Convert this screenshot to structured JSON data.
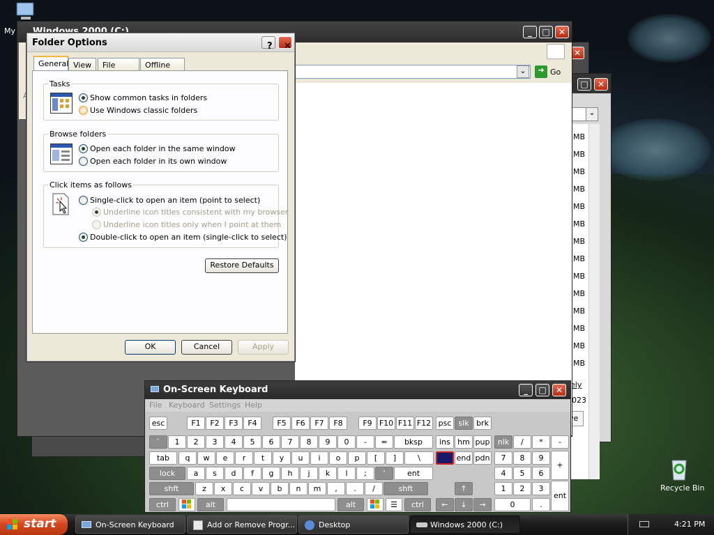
{
  "desktop": {
    "my_computer_label": "My",
    "recycle_bin_label": "Recycle Bin"
  },
  "explorer": {
    "title": "Windows 2000 (C:)",
    "go_label": "Go",
    "size_unit": "MB",
    "partial_link_1": "ely",
    "partial_text_2": "023",
    "partial_text_3": "ve",
    "partial_letter": "A"
  },
  "folder_options": {
    "title": "Folder Options",
    "tabs": [
      "General",
      "View",
      "File Types",
      "Offline Files"
    ],
    "tasks_group": "Tasks",
    "tasks_options": [
      "Show common tasks in folders",
      "Use Windows classic folders"
    ],
    "browse_group": "Browse folders",
    "browse_options": [
      "Open each folder in the same window",
      "Open each folder in its own window"
    ],
    "click_group": "Click items as follows",
    "click_options": [
      "Single-click to open an item (point to select)",
      "Underline icon titles consistent with my browser",
      "Underline icon titles only when I point at them",
      "Double-click to open an item (single-click to select)"
    ],
    "restore_defaults": "Restore Defaults",
    "ok": "OK",
    "cancel": "Cancel",
    "apply": "Apply",
    "help_glyph": "?",
    "close_glyph": "✕"
  },
  "osk": {
    "title": "On-Screen Keyboard",
    "menu": [
      "File",
      "Keyboard",
      "Settings",
      "Help"
    ],
    "row1": [
      "esc",
      "F1",
      "F2",
      "F3",
      "F4",
      "F5",
      "F6",
      "F7",
      "F8",
      "F9",
      "F10",
      "F11",
      "F12",
      "psc",
      "slk",
      "brk"
    ],
    "row2": [
      "`",
      "1",
      "2",
      "3",
      "4",
      "5",
      "6",
      "7",
      "8",
      "9",
      "0",
      "-",
      "=",
      "bksp",
      "ins",
      "hm",
      "pup",
      "nlk",
      "/",
      "*",
      "-"
    ],
    "row3": [
      "tab",
      "q",
      "w",
      "e",
      "r",
      "t",
      "y",
      "u",
      "i",
      "o",
      "p",
      "[",
      "]",
      "\\",
      "",
      "end",
      "pdn",
      "7",
      "8",
      "9"
    ],
    "row4": [
      "lock",
      "a",
      "s",
      "d",
      "f",
      "g",
      "h",
      "j",
      "k",
      "l",
      ";",
      "'",
      "ent",
      "4",
      "5",
      "6",
      "+"
    ],
    "row5": [
      "shft",
      "z",
      "x",
      "c",
      "v",
      "b",
      "n",
      "m",
      ",",
      ".",
      "/",
      "shft",
      "↑",
      "1",
      "2",
      "3"
    ],
    "row6": [
      "ctrl",
      "alt",
      "",
      "alt",
      "ctrl",
      "←",
      "↓",
      "→",
      "0",
      ".",
      "ent"
    ]
  },
  "taskbar": {
    "start": "start",
    "tasks": [
      "On-Screen Keyboard",
      "Add or Remove Progr...",
      "Desktop",
      "Windows 2000 (C:)"
    ],
    "clock": "4:21 PM"
  },
  "colors": {
    "start_orange": "#d2461f",
    "selected_key": "#1a1a6a",
    "selected_tab_accent": "#f7b43b"
  }
}
